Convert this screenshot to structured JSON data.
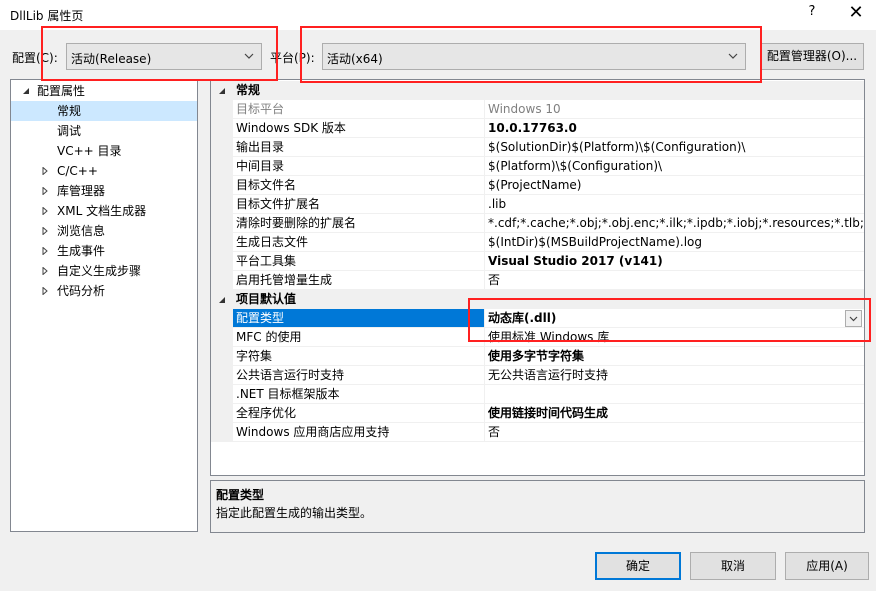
{
  "window": {
    "title": "DllLib 属性页",
    "help_glyph": "?",
    "close_glyph": "✕"
  },
  "config_bar": {
    "config_label": "配置(C):",
    "config_value": "活动(Release)",
    "platform_label": "平台(P):",
    "platform_value": "活动(x64)",
    "manager_button": "配置管理器(O)..."
  },
  "tree": {
    "items": [
      {
        "label": "配置属性",
        "expander": "expanded"
      },
      {
        "label": "常规",
        "expander": "none",
        "selected": true
      },
      {
        "label": "调试",
        "expander": "none"
      },
      {
        "label": "VC++ 目录",
        "expander": "none"
      },
      {
        "label": "C/C++",
        "expander": "collapsed"
      },
      {
        "label": "库管理器",
        "expander": "collapsed"
      },
      {
        "label": "XML 文档生成器",
        "expander": "collapsed"
      },
      {
        "label": "浏览信息",
        "expander": "collapsed"
      },
      {
        "label": "生成事件",
        "expander": "collapsed"
      },
      {
        "label": "自定义生成步骤",
        "expander": "collapsed"
      },
      {
        "label": "代码分析",
        "expander": "collapsed"
      }
    ]
  },
  "grid": {
    "categories": [
      {
        "label": "常规",
        "rows": [
          {
            "key": "目标平台",
            "value": "Windows 10",
            "dim": true
          },
          {
            "key": "Windows SDK 版本",
            "value": "10.0.17763.0",
            "bold": true
          },
          {
            "key": "输出目录",
            "value": "$(SolutionDir)$(Platform)\\$(Configuration)\\"
          },
          {
            "key": "中间目录",
            "value": "$(Platform)\\$(Configuration)\\"
          },
          {
            "key": "目标文件名",
            "value": "$(ProjectName)"
          },
          {
            "key": "目标文件扩展名",
            "value": ".lib"
          },
          {
            "key": "清除时要删除的扩展名",
            "value": "*.cdf;*.cache;*.obj;*.obj.enc;*.ilk;*.ipdb;*.iobj;*.resources;*.tlb;*.tli;*.t"
          },
          {
            "key": "生成日志文件",
            "value": "$(IntDir)$(MSBuildProjectName).log"
          },
          {
            "key": "平台工具集",
            "value": "Visual Studio 2017 (v141)",
            "bold": true
          },
          {
            "key": "启用托管增量生成",
            "value": "否"
          }
        ]
      },
      {
        "label": "项目默认值",
        "rows": [
          {
            "key": "配置类型",
            "value": "动态库(.dll)",
            "bold": true,
            "selected": true
          },
          {
            "key": "MFC 的使用",
            "value": "使用标准 Windows 库"
          },
          {
            "key": "字符集",
            "value": "使用多字节字符集",
            "bold": true
          },
          {
            "key": "公共语言运行时支持",
            "value": "无公共语言运行时支持"
          },
          {
            "key": ".NET 目标框架版本",
            "value": ""
          },
          {
            "key": "全程序优化",
            "value": "使用链接时间代码生成",
            "bold": true
          },
          {
            "key": "Windows 应用商店应用支持",
            "value": "否"
          }
        ]
      }
    ]
  },
  "description": {
    "title": "配置类型",
    "text": "指定此配置生成的输出类型。"
  },
  "buttons": {
    "ok": "确定",
    "cancel": "取消",
    "apply": "应用(A)"
  },
  "colors": {
    "selection": "#0078d7",
    "tree_selection": "#cce8ff",
    "annotation": "#ff2020"
  }
}
